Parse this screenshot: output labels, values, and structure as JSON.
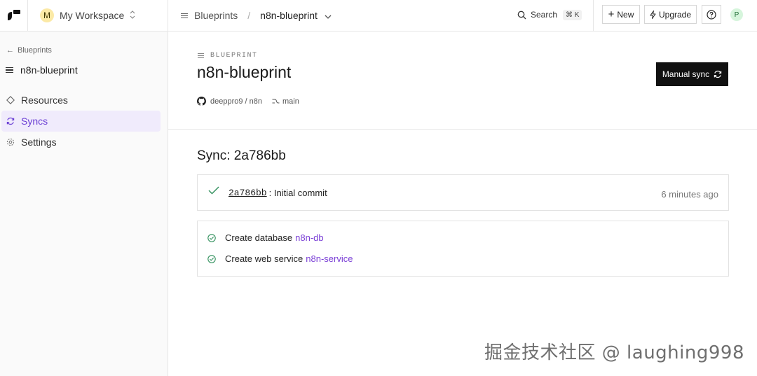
{
  "topbar": {
    "workspace": {
      "avatar_letter": "M",
      "name": "My Workspace"
    },
    "breadcrumb": {
      "parent": "Blueprints",
      "separator": "/",
      "current": "n8n-blueprint"
    },
    "search": {
      "label": "Search",
      "shortcut": "⌘ K"
    },
    "new_label": "New",
    "upgrade_label": "Upgrade",
    "help_icon": "question-circle-icon",
    "user_avatar_letter": "P"
  },
  "sidebar": {
    "back_label": "Blueprints",
    "title": "n8n-blueprint",
    "items": [
      {
        "label": "Resources",
        "icon": "diamond-icon",
        "active": false
      },
      {
        "label": "Syncs",
        "icon": "sync-icon",
        "active": true
      },
      {
        "label": "Settings",
        "icon": "gear-icon",
        "active": false
      }
    ]
  },
  "header": {
    "type_label": "BLUEPRINT",
    "title": "n8n-blueprint",
    "repo": "deeppro9 / n8n",
    "branch": "main",
    "manual_sync_label": "Manual sync"
  },
  "sync": {
    "heading": "Sync: 2a786bb",
    "commit": {
      "hash": "2a786bb",
      "message": ": Initial commit",
      "time": "6 minutes ago"
    },
    "steps": [
      {
        "text": "Create database",
        "link": "n8n-db"
      },
      {
        "text": "Create web service",
        "link": "n8n-service"
      }
    ]
  },
  "watermark": "掘金技术社区 @ laughing998",
  "colors": {
    "accent": "#7a3fd6",
    "active_bg": "#f0ebfc",
    "success": "#2f8f5b",
    "primary_button": "#111111"
  }
}
